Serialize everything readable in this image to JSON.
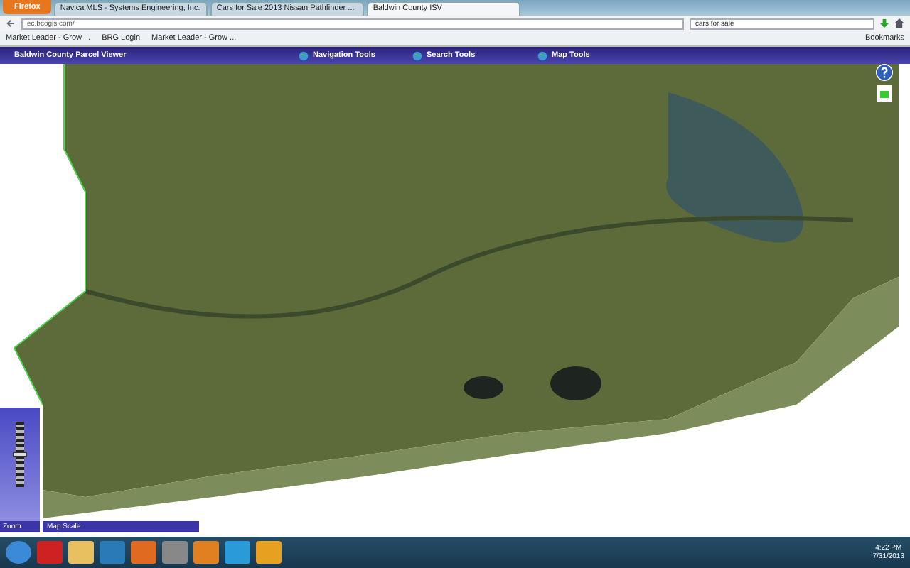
{
  "browser": {
    "menu_button": "Firefox",
    "tabs": [
      {
        "label": "Navica MLS - Systems Engineering, Inc.",
        "selected": false
      },
      {
        "label": "Cars for Sale 2013 Nissan Pathfinder ...",
        "selected": false
      },
      {
        "label": "Baldwin County ISV",
        "selected": true
      }
    ],
    "url": "ec.bcogis.com/",
    "search": {
      "value": "cars for sale"
    },
    "bookmarks": [
      "Market Leader - Grow ...",
      "BRG Login",
      "Market Leader - Grow ..."
    ],
    "bookmarks_menu": "Bookmarks"
  },
  "app": {
    "title": "Baldwin County Parcel Viewer",
    "tools": [
      "Navigation Tools",
      "Search Tools",
      "Map Tools"
    ],
    "zoom_slider": {
      "level": 0.5
    },
    "zoom_label": "Zoom",
    "map_scale_label": "Map Scale"
  },
  "taskbar": {
    "time": "4:22 PM",
    "date": "7/31/2013"
  }
}
